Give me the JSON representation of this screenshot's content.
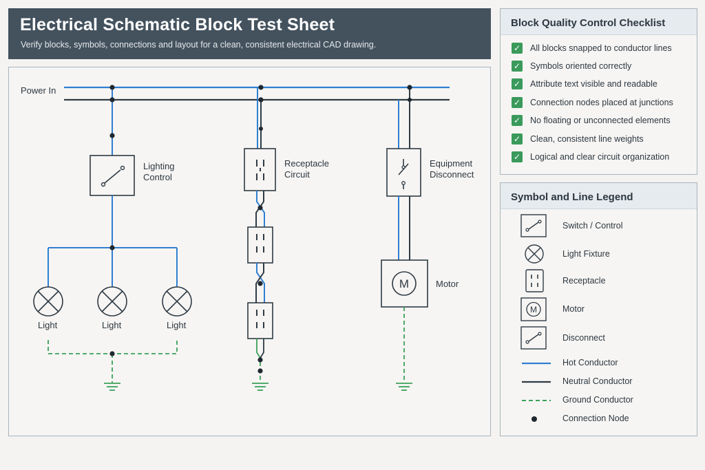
{
  "header": {
    "title": "Electrical Schematic Block Test Sheet",
    "subtitle": "Verify blocks, symbols, connections and layout for a clean, consistent electrical CAD drawing."
  },
  "diagram": {
    "power_in_label": "Power In",
    "lighting_control_label": "Lighting\nControl",
    "light_label_1": "Light",
    "light_label_2": "Light",
    "light_label_3": "Light",
    "receptacle_circuit_label": "Receptacle\nCircuit",
    "equipment_disconnect_label": "Equipment\nDisconnect",
    "motor_symbol_letter": "M",
    "motor_label": "Motor"
  },
  "checklist": {
    "title": "Block Quality Control Checklist",
    "check_glyph": "✓",
    "items": [
      "All blocks snapped to conductor lines",
      "Symbols oriented correctly",
      "Attribute text visible and readable",
      "Connection nodes placed at junctions",
      "No floating or unconnected elements",
      "Clean, consistent line weights",
      "Logical and clear circuit organization"
    ]
  },
  "legend": {
    "title": "Symbol and Line Legend",
    "motor_letter": "M",
    "items": [
      "Switch / Control",
      "Light Fixture",
      "Receptacle",
      "Motor",
      "Disconnect",
      "Hot Conductor",
      "Neutral Conductor",
      "Ground Conductor",
      "Connection Node"
    ]
  },
  "colors": {
    "hot": "#2f7fd1",
    "neutral": "#2f3a44",
    "ground": "#3aa05a",
    "header_bg": "#44525e",
    "check": "#3a9a5b"
  }
}
